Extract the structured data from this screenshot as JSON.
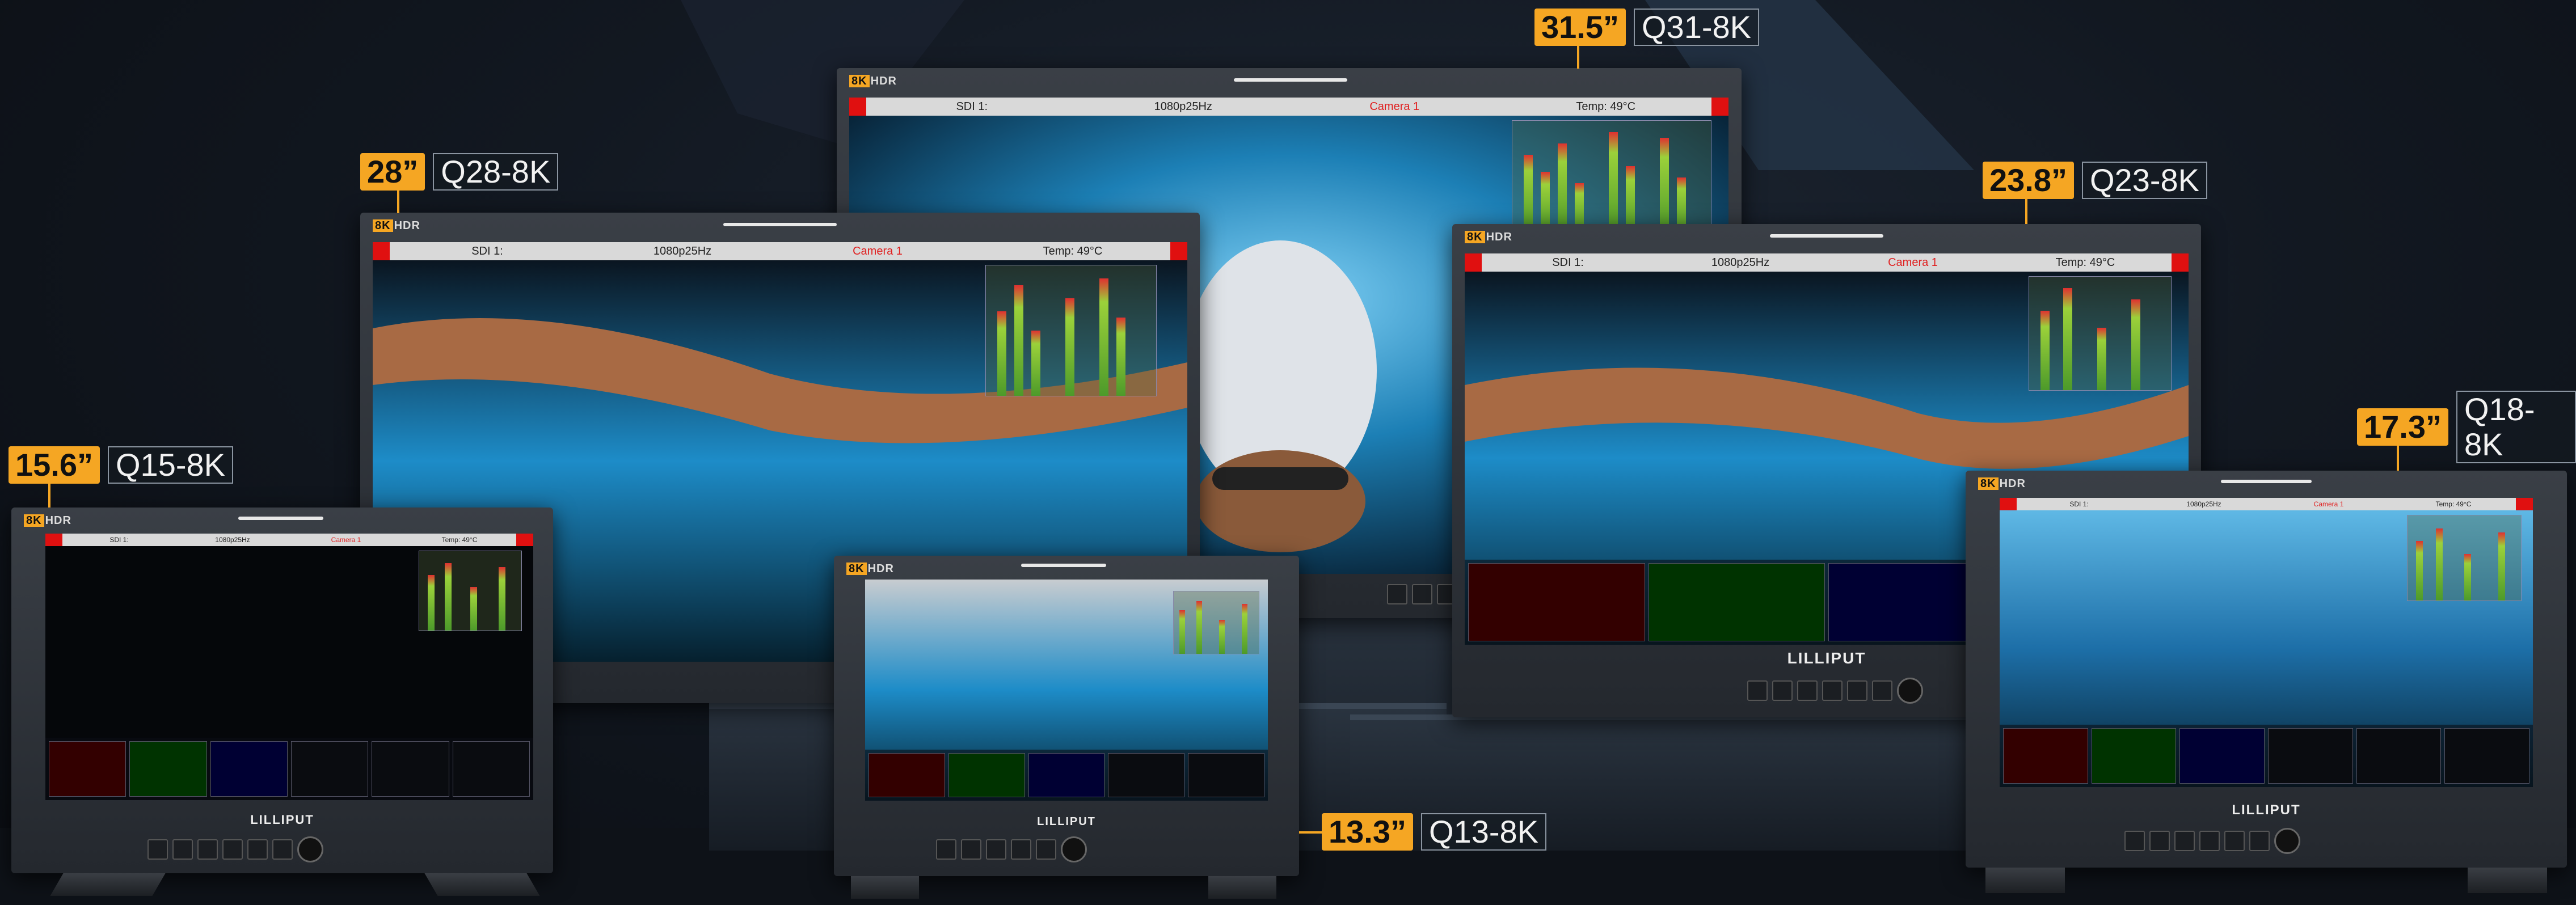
{
  "brand": "LILLIPUT",
  "badge": {
    "hl": "8K",
    "rest": "HDR"
  },
  "status_bar": {
    "input": "SDI 1:",
    "format": "1080p25Hz",
    "camera": "Camera 1",
    "temp": "Temp: 49°C"
  },
  "monitors": {
    "q31": {
      "size": "31.5”",
      "model": "Q31-8K"
    },
    "q28": {
      "size": "28”",
      "model": "Q28-8K"
    },
    "q23": {
      "size": "23.8”",
      "model": "Q23-8K"
    },
    "q18": {
      "size": "17.3”",
      "model": "Q18-8K"
    },
    "q15": {
      "size": "15.6”",
      "model": "Q15-8K"
    },
    "q13": {
      "size": "13.3”",
      "model": "Q13-8K"
    }
  },
  "colors": {
    "accent": "#f5a623",
    "status_red": "#e01010",
    "water": "#1e90c8"
  }
}
